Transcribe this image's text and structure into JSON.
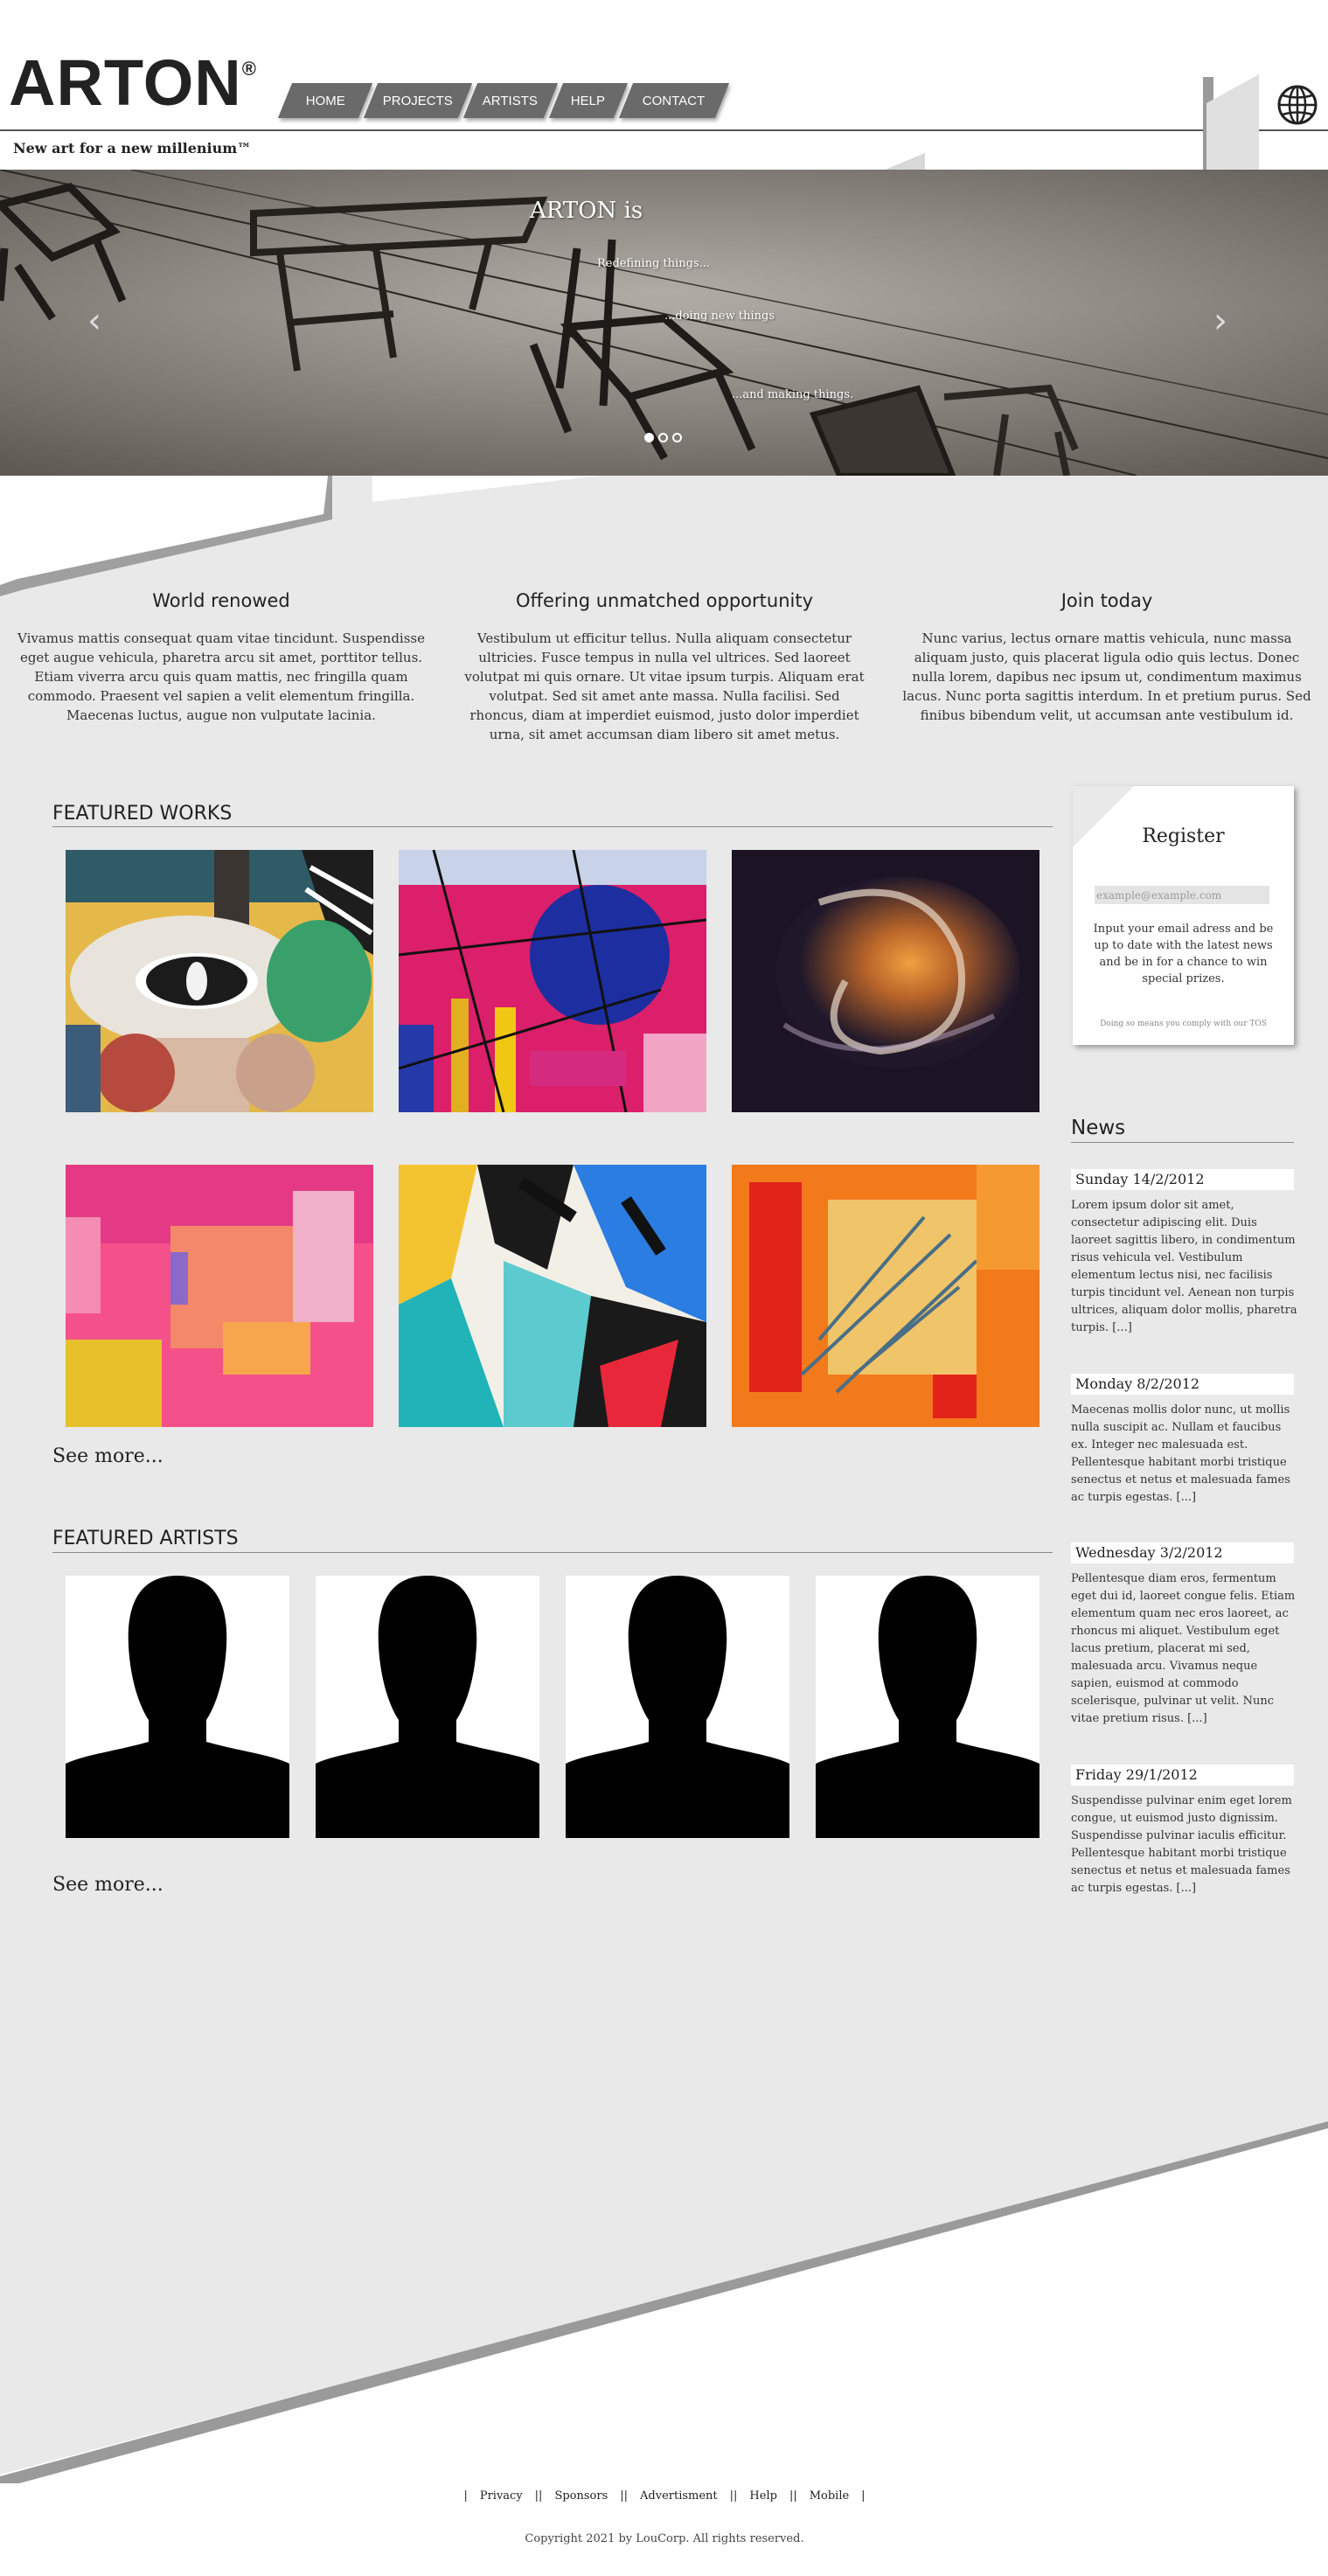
{
  "brand": {
    "logo": "ARTON",
    "logo_mark": "®",
    "tagline": "New art for a new millenium™"
  },
  "nav": [
    "HOME",
    "PROJECTS",
    "ARTISTS",
    "HELP",
    "CONTACT"
  ],
  "carousel": {
    "title": "ARTON is",
    "lines": [
      "Redefining things...",
      "...doing new things",
      "...and making things."
    ],
    "prev": "‹",
    "next": "›",
    "slides": 3,
    "active_slide": 1
  },
  "intro": [
    {
      "title": "World renowed",
      "text": "Vivamus mattis consequat quam vitae tincidunt. Suspendisse eget augue vehicula, pharetra arcu sit amet, porttitor tellus. Etiam viverra arcu quis quam mattis, nec fringilla quam commodo. Praesent vel sapien a velit elementum fringilla. Maecenas luctus, augue non vulputate lacinia."
    },
    {
      "title": "Offering unmatched opportunity",
      "text": "Vestibulum ut efficitur tellus. Nulla aliquam consectetur ultricies. Fusce tempus in nulla vel ultrices. Sed laoreet volutpat mi quis ornare. Ut vitae ipsum turpis. Aliquam erat volutpat. Sed sit amet ante massa. Nulla facilisi. Sed rhoncus, diam at imperdiet euismod, justo dolor imperdiet urna, sit amet accumsan diam libero sit amet metus."
    },
    {
      "title": "Join today",
      "text": "Nunc varius, lectus ornare mattis vehicula, nunc massa aliquam justo, quis placerat ligula odio quis lectus. Donec nulla lorem, dapibus nec ipsum ut, condimentum maximus lacus. Nunc porta sagittis interdum. In et pretium purus. Sed finibus bibendum velit, ut accumsan ante vestibulum id."
    }
  ],
  "featured_works": {
    "title": "FEATURED WORKS",
    "see_more": "See more..."
  },
  "featured_artists": {
    "title": "FEATURED ARTISTS",
    "see_more": "See more..."
  },
  "register": {
    "title": "Register",
    "placeholder": "example@example.com",
    "text": "Input your email adress and be up to date with the latest news and be in for a chance to win special prizes.",
    "tos": "Doing so means you comply with our TOS"
  },
  "news": {
    "title": "News",
    "items": [
      {
        "date": "Sunday 14/2/2012",
        "text": "Lorem ipsum dolor sit amet, consectetur adipiscing elit. Duis laoreet sagittis libero, in condimentum risus vehicula vel. Vestibulum elementum lectus nisi, nec facilisis turpis tincidunt vel. Aenean non turpis ultrices, aliquam dolor mollis, pharetra turpis. [...]"
      },
      {
        "date": "Monday 8/2/2012",
        "text": "Maecenas mollis dolor nunc, ut mollis nulla suscipit ac. Nullam et faucibus ex. Integer nec malesuada est. Pellentesque habitant morbi tristique senectus et netus et malesuada fames ac turpis egestas. [...]"
      },
      {
        "date": "Wednesday 3/2/2012",
        "text": "Pellentesque diam eros, fermentum eget dui id, laoreet congue felis. Etiam elementum quam nec eros laoreet, ac rhoncus mi aliquet. Vestibulum eget lacus pretium, placerat mi sed, malesuada arcu. Vivamus neque sapien, euismod at commodo scelerisque, pulvinar ut velit. Nunc vitae pretium risus. [...]"
      },
      {
        "date": "Friday 29/1/2012",
        "text": "Suspendisse pulvinar enim eget lorem congue, ut euismod justo dignissim. Suspendisse pulvinar iaculis efficitur. Pellentesque habitant morbi tristique senectus et netus et malesuada fames ac turpis egestas. [...]"
      }
    ]
  },
  "footer": {
    "links": [
      "Privacy",
      "Sponsors",
      "Advertisment",
      "Help",
      "Mobile"
    ],
    "separator": "||",
    "edge": "|",
    "copyright": "Copyright 2021 by LouCorp. All rights reserved."
  },
  "colors": {
    "nav_bg": "#6a6a6a",
    "page_bg": "#e9e9e9",
    "accent_dark": "#222222"
  }
}
